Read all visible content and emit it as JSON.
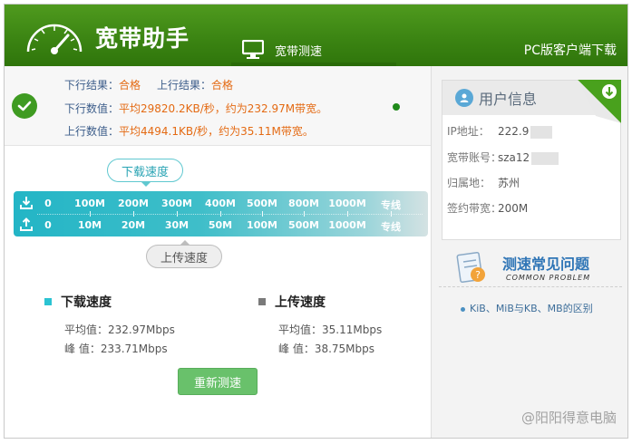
{
  "header": {
    "app_title": "宽带助手",
    "tab_speed": "宽带测速",
    "pc_download": "PC版客户端下载"
  },
  "results": {
    "down_result_label": "下行结果：",
    "down_result_value": "合格",
    "up_result_label": "上行结果：",
    "up_result_value": "合格",
    "down_value_label": "下行数值：",
    "down_value_text": "平均29820.2KB/秒，约为232.97M带宽。",
    "up_value_label": "上行数值：",
    "up_value_text": "平均4494.1KB/秒，约为35.11M带宽。"
  },
  "scale": {
    "download_pill": "下载速度",
    "upload_pill": "上传速度",
    "download_ticks": [
      "0",
      "100M",
      "200M",
      "300M",
      "400M",
      "500M",
      "800M",
      "1000M",
      "专线"
    ],
    "upload_ticks": [
      "0",
      "10M",
      "20M",
      "30M",
      "50M",
      "100M",
      "500M",
      "1000M",
      "专线"
    ]
  },
  "stats": {
    "download_title": "下载速度",
    "download_avg": "平均值：232.97Mbps",
    "download_peak": "峰 值：233.71Mbps",
    "upload_title": "上传速度",
    "upload_avg": "平均值：35.11Mbps",
    "upload_peak": "峰 值：38.75Mbps",
    "retest_button": "重新测速",
    "download_color": "#2bc3d2",
    "upload_color": "#7a7a7a"
  },
  "user_info": {
    "title": "用户信息",
    "ip_label": "IP地址：",
    "ip_value": "222.9",
    "account_label": "宽带账号：",
    "account_value": "sza12",
    "region_label": "归属地：",
    "region_value": "苏州",
    "bandwidth_label": "签约带宽：",
    "bandwidth_value": "200M"
  },
  "faq": {
    "title": "测速常见问题",
    "subtitle": "COMMON PROBLEM",
    "link": "KiB、MiB与KB、MB的区别"
  },
  "watermark": "@阳阳得意电脑",
  "colors": {
    "header_green": "#3a8312",
    "accent_orange": "#e46a13",
    "label_blue": "#3c5d8a",
    "scale_teal": "#23b5c6",
    "button_green": "#69c16b"
  }
}
